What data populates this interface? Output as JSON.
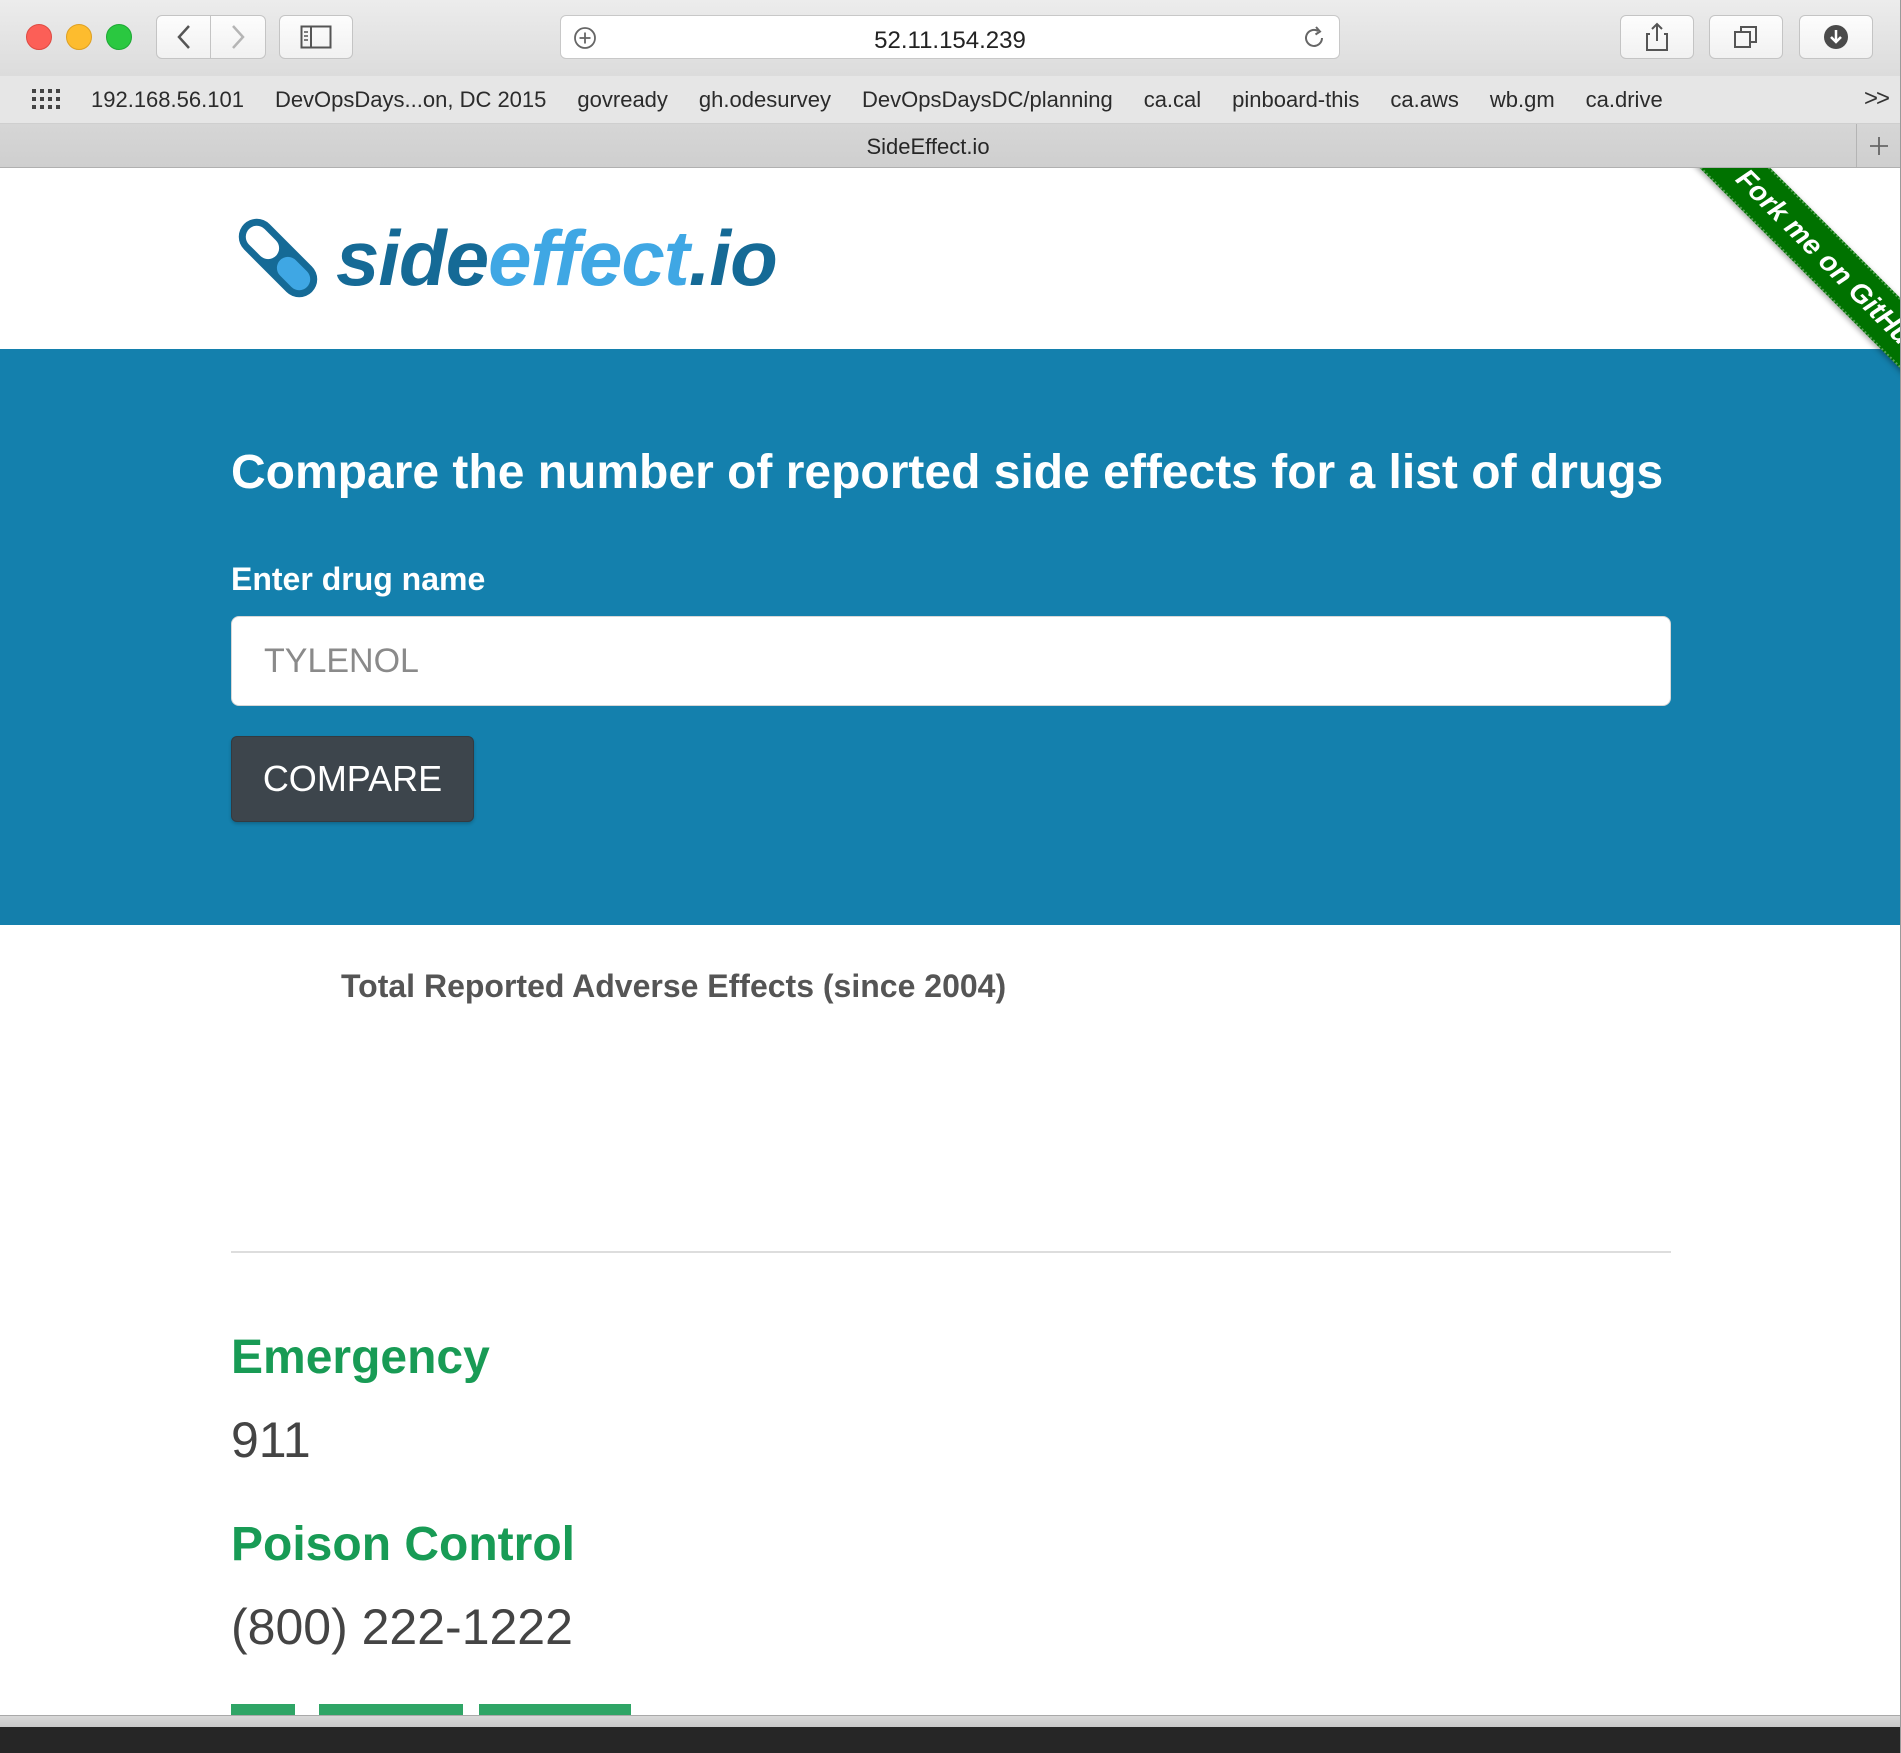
{
  "browser": {
    "url": "52.11.154.239",
    "tab_title": "SideEffect.io",
    "bookmarks": [
      "192.168.56.101",
      "DevOpsDays...on, DC 2015",
      "govready",
      "gh.odesurvey",
      "DevOpsDaysDC/planning",
      "ca.cal",
      "pinboard-this",
      "ca.aws",
      "wb.gm",
      "ca.drive"
    ],
    "more_bookmarks": ">>"
  },
  "site": {
    "logo_part1": "side",
    "logo_part2": "effect",
    "logo_part3": ".io",
    "ribbon": "Fork me on GitHub"
  },
  "hero": {
    "heading": "Compare the number of reported side effects for a list of drugs",
    "input_label": "Enter drug name",
    "input_placeholder": "TYLENOL",
    "compare_button": "COMPARE"
  },
  "results": {
    "title": "Total Reported Adverse Effects (since 2004)"
  },
  "contacts": [
    {
      "heading": "Emergency",
      "value": "911"
    },
    {
      "heading": "Poison Control",
      "value": "(800) 222-1222"
    }
  ],
  "colors": {
    "hero_bg": "#1480ad",
    "button_bg": "#3d454c",
    "contact_heading": "#189b55",
    "ribbon": "#007200",
    "logo_dark": "#156a96",
    "logo_light": "#3fa7e4"
  }
}
